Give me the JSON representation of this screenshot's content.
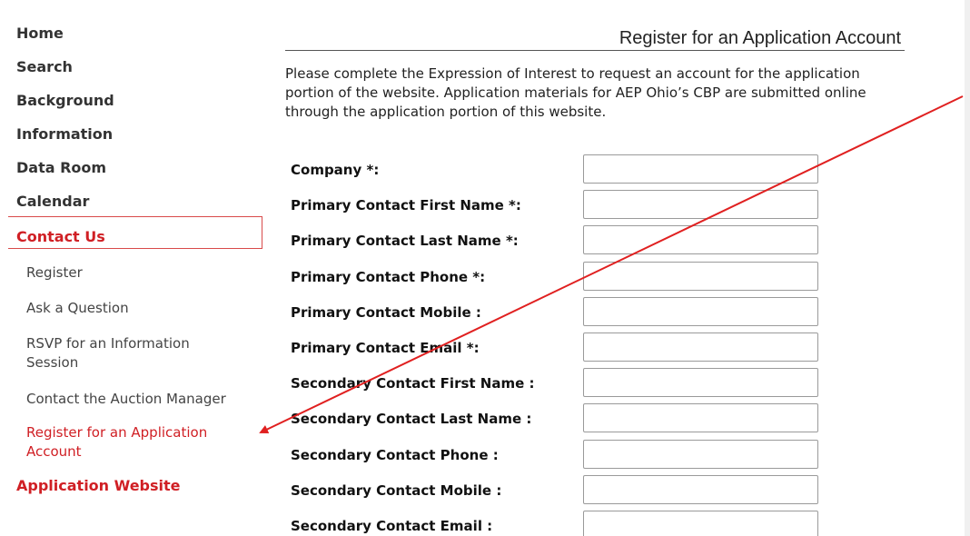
{
  "sidebar": {
    "nav": [
      {
        "label": "Home",
        "name": "nav-home"
      },
      {
        "label": "Search",
        "name": "nav-search"
      },
      {
        "label": "Background",
        "name": "nav-background"
      },
      {
        "label": "Information",
        "name": "nav-information"
      },
      {
        "label": "Data Room",
        "name": "nav-data-room"
      },
      {
        "label": "Calendar",
        "name": "nav-calendar"
      },
      {
        "label": "Contact Us",
        "name": "nav-contact-us",
        "active": true
      }
    ],
    "sub": [
      {
        "lines": [
          "Register"
        ],
        "name": "sub-register"
      },
      {
        "lines": [
          "Ask a Question"
        ],
        "name": "sub-ask-question"
      },
      {
        "lines": [
          "RSVP for an Information",
          "Session"
        ],
        "name": "sub-rsvp-info-session"
      },
      {
        "lines": [
          "Contact the Auction Manager"
        ],
        "name": "sub-contact-auction-manager"
      },
      {
        "lines": [
          "Register for an Application",
          "Account"
        ],
        "name": "sub-register-app-account",
        "current": true
      }
    ],
    "app_website": "Application Website"
  },
  "main": {
    "title": "Register for an Application Account",
    "intro": [
      "Please complete the Expression of Interest to request an account for the application",
      "portion of the website. Application materials for AEP Ohio’s CBP are submitted online",
      "through the application portion of this website."
    ],
    "fields": [
      {
        "label": "Company *:",
        "name": "company",
        "value": ""
      },
      {
        "label": "Primary Contact First Name *:",
        "name": "primary-first-name",
        "value": ""
      },
      {
        "label": "Primary Contact Last Name *:",
        "name": "primary-last-name",
        "value": ""
      },
      {
        "label": "Primary Contact Phone *:",
        "name": "primary-phone",
        "value": ""
      },
      {
        "label": "Primary Contact Mobile :",
        "name": "primary-mobile",
        "value": ""
      },
      {
        "label": "Primary Contact Email *:",
        "name": "primary-email",
        "value": ""
      },
      {
        "label": "Secondary Contact First Name :",
        "name": "secondary-first-name",
        "value": ""
      },
      {
        "label": "Secondary Contact Last Name :",
        "name": "secondary-last-name",
        "value": ""
      },
      {
        "label": "Secondary Contact Phone :",
        "name": "secondary-phone",
        "value": ""
      },
      {
        "label": "Secondary Contact Mobile :",
        "name": "secondary-mobile",
        "value": ""
      },
      {
        "label": "Secondary Contact Email :",
        "name": "secondary-email",
        "value": ""
      }
    ]
  },
  "colors": {
    "accent": "#d01f24",
    "arrow": "#e02020"
  }
}
